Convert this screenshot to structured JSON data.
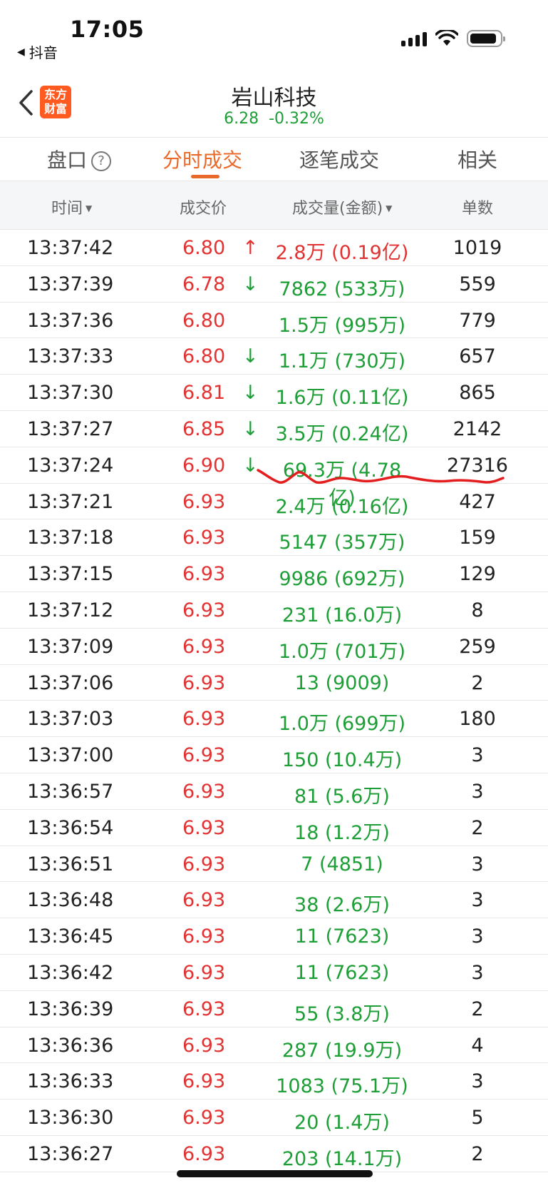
{
  "status": {
    "time": "17:05",
    "back_app": "抖音"
  },
  "header": {
    "logo_text": "东方财富",
    "stock_name": "岩山科技",
    "price": "6.28",
    "change": "-0.32%"
  },
  "tabs": [
    {
      "label": "盘口"
    },
    {
      "label": "分时成交"
    },
    {
      "label": "逐笔成交"
    },
    {
      "label": "相关"
    }
  ],
  "columns": {
    "time": "时间",
    "price": "成交价",
    "volume": "成交量(金额)",
    "count": "单数"
  },
  "rows": [
    {
      "time": "13:37:42",
      "price": "6.80",
      "arrow": "up",
      "volume": "2.8万 (0.19亿)",
      "vol_color": "red",
      "count": "1019"
    },
    {
      "time": "13:37:39",
      "price": "6.78",
      "arrow": "down",
      "volume": "7862 (533万)",
      "vol_color": "green",
      "count": "559"
    },
    {
      "time": "13:37:36",
      "price": "6.80",
      "arrow": "",
      "volume": "1.5万 (995万)",
      "vol_color": "green",
      "count": "779"
    },
    {
      "time": "13:37:33",
      "price": "6.80",
      "arrow": "down",
      "volume": "1.1万 (730万)",
      "vol_color": "green",
      "count": "657"
    },
    {
      "time": "13:37:30",
      "price": "6.81",
      "arrow": "down",
      "volume": "1.6万 (0.11亿)",
      "vol_color": "green",
      "count": "865"
    },
    {
      "time": "13:37:27",
      "price": "6.85",
      "arrow": "down",
      "volume": "3.5万 (0.24亿)",
      "vol_color": "green",
      "count": "2142"
    },
    {
      "time": "13:37:24",
      "price": "6.90",
      "arrow": "down",
      "volume": "69.3万 (4.78亿)",
      "vol_color": "green",
      "count": "27316"
    },
    {
      "time": "13:37:21",
      "price": "6.93",
      "arrow": "",
      "volume": "2.4万 (0.16亿)",
      "vol_color": "green",
      "count": "427"
    },
    {
      "time": "13:37:18",
      "price": "6.93",
      "arrow": "",
      "volume": "5147 (357万)",
      "vol_color": "green",
      "count": "159"
    },
    {
      "time": "13:37:15",
      "price": "6.93",
      "arrow": "",
      "volume": "9986 (692万)",
      "vol_color": "green",
      "count": "129"
    },
    {
      "time": "13:37:12",
      "price": "6.93",
      "arrow": "",
      "volume": "231 (16.0万)",
      "vol_color": "green",
      "count": "8"
    },
    {
      "time": "13:37:09",
      "price": "6.93",
      "arrow": "",
      "volume": "1.0万 (701万)",
      "vol_color": "green",
      "count": "259"
    },
    {
      "time": "13:37:06",
      "price": "6.93",
      "arrow": "",
      "volume": "13 (9009)",
      "vol_color": "green",
      "count": "2"
    },
    {
      "time": "13:37:03",
      "price": "6.93",
      "arrow": "",
      "volume": "1.0万 (699万)",
      "vol_color": "green",
      "count": "180"
    },
    {
      "time": "13:37:00",
      "price": "6.93",
      "arrow": "",
      "volume": "150 (10.4万)",
      "vol_color": "green",
      "count": "3"
    },
    {
      "time": "13:36:57",
      "price": "6.93",
      "arrow": "",
      "volume": "81 (5.6万)",
      "vol_color": "green",
      "count": "3"
    },
    {
      "time": "13:36:54",
      "price": "6.93",
      "arrow": "",
      "volume": "18 (1.2万)",
      "vol_color": "green",
      "count": "2"
    },
    {
      "time": "13:36:51",
      "price": "6.93",
      "arrow": "",
      "volume": "7 (4851)",
      "vol_color": "green",
      "count": "3"
    },
    {
      "time": "13:36:48",
      "price": "6.93",
      "arrow": "",
      "volume": "38 (2.6万)",
      "vol_color": "green",
      "count": "3"
    },
    {
      "time": "13:36:45",
      "price": "6.93",
      "arrow": "",
      "volume": "11 (7623)",
      "vol_color": "green",
      "count": "3"
    },
    {
      "time": "13:36:42",
      "price": "6.93",
      "arrow": "",
      "volume": "11 (7623)",
      "vol_color": "green",
      "count": "3"
    },
    {
      "time": "13:36:39",
      "price": "6.93",
      "arrow": "",
      "volume": "55 (3.8万)",
      "vol_color": "green",
      "count": "2"
    },
    {
      "time": "13:36:36",
      "price": "6.93",
      "arrow": "",
      "volume": "287 (19.9万)",
      "vol_color": "green",
      "count": "4"
    },
    {
      "time": "13:36:33",
      "price": "6.93",
      "arrow": "",
      "volume": "1083 (75.1万)",
      "vol_color": "green",
      "count": "3"
    },
    {
      "time": "13:36:30",
      "price": "6.93",
      "arrow": "",
      "volume": "20 (1.4万)",
      "vol_color": "green",
      "count": "5"
    },
    {
      "time": "13:36:27",
      "price": "6.93",
      "arrow": "",
      "volume": "203 (14.1万)",
      "vol_color": "green",
      "count": "2"
    }
  ],
  "colors": {
    "up": "#e23232",
    "down": "#1e9e36",
    "accent": "#e8692a",
    "logo": "#ff5a1f"
  }
}
